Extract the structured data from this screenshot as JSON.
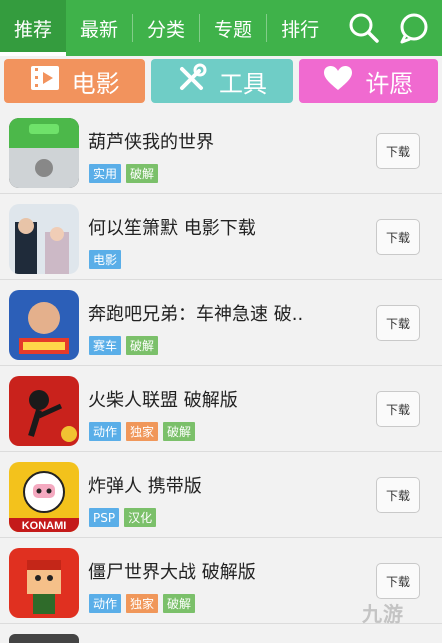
{
  "tabs": [
    {
      "label": "推荐"
    },
    {
      "label": "最新"
    },
    {
      "label": "分类"
    },
    {
      "label": "专题"
    },
    {
      "label": "排行"
    }
  ],
  "categories": {
    "movie": "电影",
    "tools": "工具",
    "wish": "许愿"
  },
  "apps": [
    {
      "title": "葫芦侠我的世界",
      "tags": [
        "实用",
        "破解"
      ],
      "download": "下载"
    },
    {
      "title": "何以笙箫默  电影下载",
      "tags": [
        "电影"
      ],
      "download": "下载"
    },
    {
      "title": "奔跑吧兄弟：车神急速  破..",
      "tags": [
        "赛车",
        "破解"
      ],
      "download": "下载"
    },
    {
      "title": "火柴人联盟  破解版",
      "tags": [
        "动作",
        "独家",
        "破解"
      ],
      "download": "下载"
    },
    {
      "title": "炸弹人  携带版",
      "tags": [
        "PSP",
        "汉化"
      ],
      "download": "下载"
    },
    {
      "title": "僵尸世界大战  破解版",
      "tags": [
        "动作",
        "独家",
        "破解"
      ],
      "download": "下载"
    }
  ],
  "icon_texts": {
    "bomberman": "KONAMI"
  },
  "watermark": "九游",
  "colors": {
    "topbar": "#3fb24a",
    "movie": "#f2935d",
    "tools": "#6fcdc6",
    "wish": "#f06ad0",
    "tag_blue": "#5aaee8",
    "tag_green": "#7bc06a",
    "tag_orange": "#f0975a"
  },
  "icons": [
    "search-icon",
    "chat-icon",
    "film-icon",
    "tools-icon",
    "heart-icon"
  ]
}
